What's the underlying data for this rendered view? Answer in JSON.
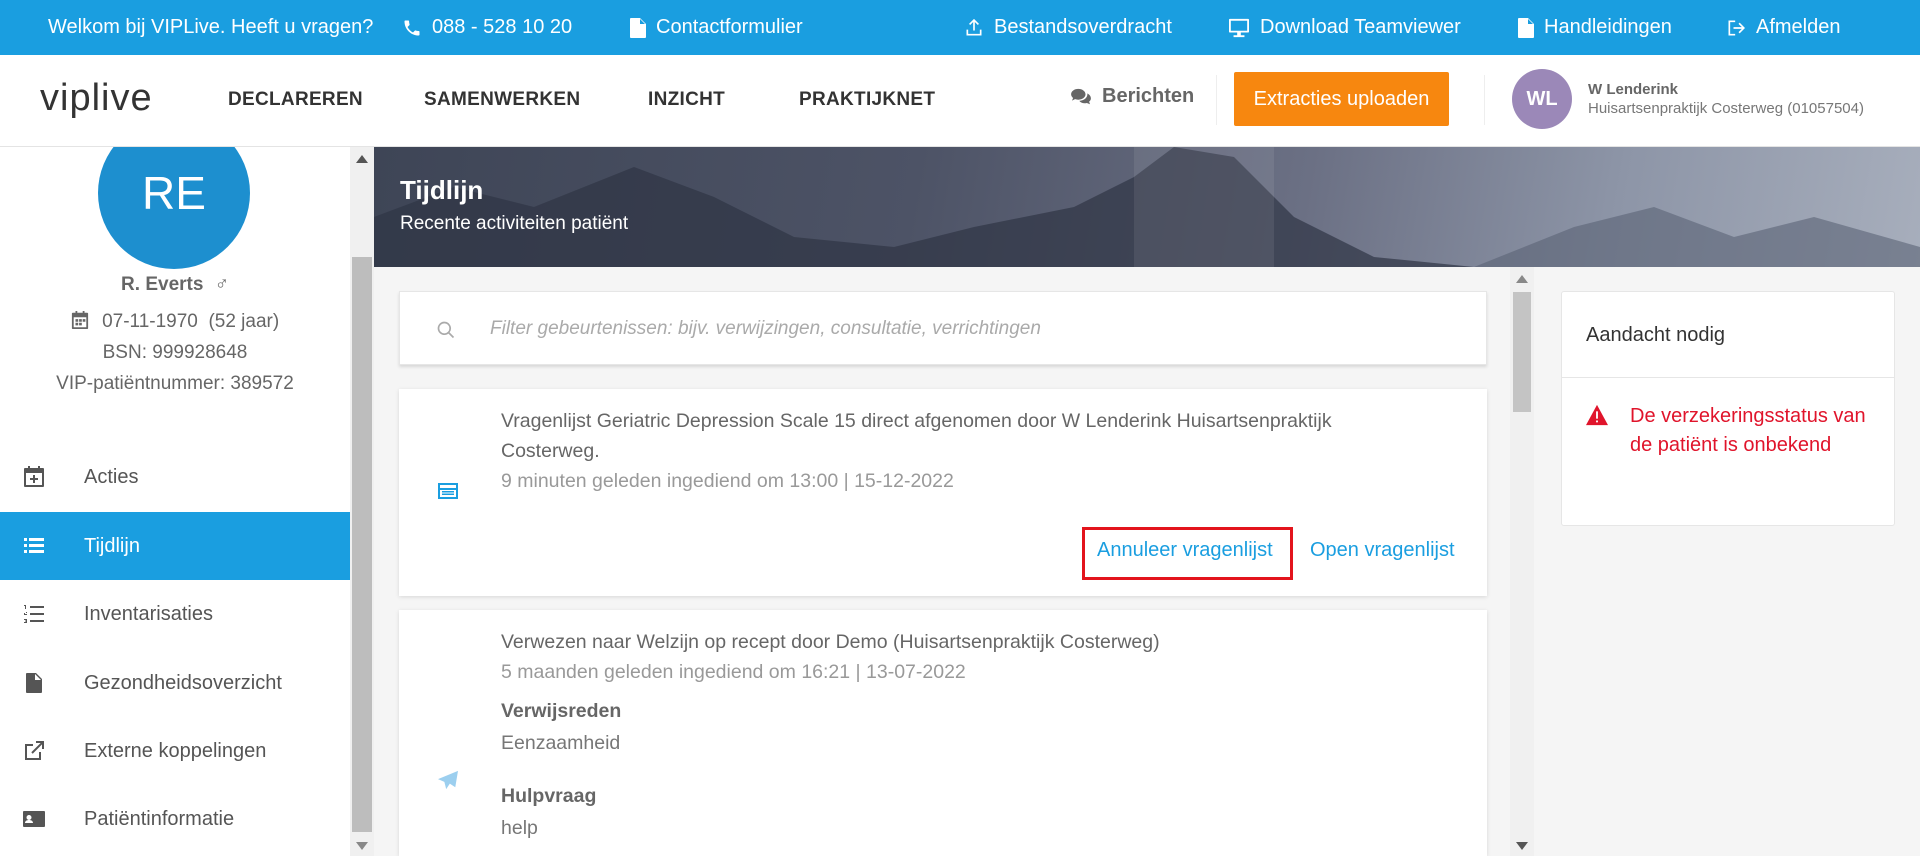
{
  "topbar": {
    "welcome": "Welkom bij VIPLive. Heeft u vragen?",
    "phone": "088 - 528 10 20",
    "contact": "Contactformulier",
    "transfer": "Bestandsoverdracht",
    "teamviewer": "Download Teamviewer",
    "manuals": "Handleidingen",
    "logout": "Afmelden"
  },
  "header": {
    "logo": "viplive",
    "nav": [
      "DECLAREREN",
      "SAMENWERKEN",
      "INZICHT",
      "PRAKTIJKNET"
    ],
    "messages": "Berichten",
    "upload": "Extracties uploaden",
    "user_initials": "WL",
    "user_name": "W Lenderink",
    "user_practice": "Huisartsenpraktijk Costerweg (01057504)"
  },
  "patient": {
    "initials": "RE",
    "name": "R. Everts",
    "gender_symbol": "♂",
    "birthdate": "07-11-1970",
    "age": "(52 jaar)",
    "bsn": "BSN: 999928648",
    "vip_number": "VIP-patiëntnummer: 389572"
  },
  "sidebar": {
    "items": [
      {
        "label": "Acties",
        "icon": "calendar-plus-icon"
      },
      {
        "label": "Tijdlijn",
        "icon": "list-icon"
      },
      {
        "label": "Inventarisaties",
        "icon": "numbered-list-icon"
      },
      {
        "label": "Gezondheidsoverzicht",
        "icon": "document-icon"
      },
      {
        "label": "Externe koppelingen",
        "icon": "external-link-icon"
      },
      {
        "label": "Patiëntinformatie",
        "icon": "id-card-icon"
      }
    ],
    "active": "Tijdlijn"
  },
  "banner": {
    "title": "Tijdlijn",
    "subtitle": "Recente activiteiten patiënt"
  },
  "filter": {
    "placeholder": "Filter gebeurtenissen: bijv. verwijzingen, consultatie, verrichtingen"
  },
  "events": [
    {
      "line1": "Vragenlijst Geriatric Depression Scale 15 direct afgenomen door W Lenderink Huisartsenpraktijk",
      "line2": "Costerweg.",
      "meta": "9 minuten geleden ingediend om 13:00 | 15-12-2022",
      "cancel": "Annuleer vragenlijst",
      "open": "Open vragenlijst",
      "icon": "form-icon"
    },
    {
      "line1": "Verwezen naar Welzijn op recept door Demo (Huisartsenpraktijk Costerweg)",
      "meta": "5 maanden geleden ingediend om 16:21 | 13-07-2022",
      "reason_label": "Verwijsreden",
      "reason": "Eenzaamheid",
      "question_label": "Hulpvraag",
      "question": "help",
      "icon": "paper-plane-icon"
    }
  ],
  "notice": {
    "title": "Aandacht nodig",
    "message": "De verzekeringsstatus van de patiënt is onbekend"
  },
  "colors": {
    "primary": "#1a9ee0",
    "accent": "#f7870f",
    "warning": "#e0142b"
  }
}
